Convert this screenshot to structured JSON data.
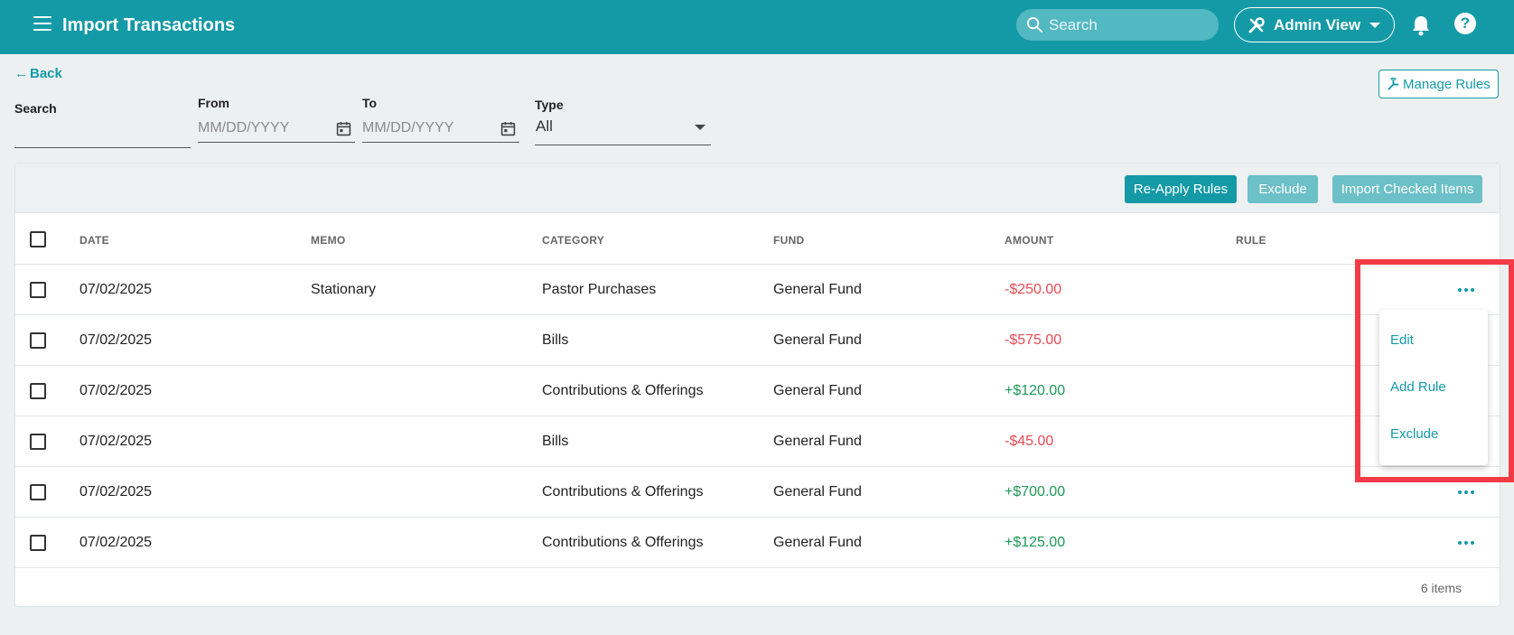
{
  "header": {
    "title": "Import Transactions",
    "search_placeholder": "Search",
    "admin_view_label": "Admin View"
  },
  "nav": {
    "back_label": "Back"
  },
  "toolbar": {
    "manage_rules_label": "Manage Rules"
  },
  "filters": {
    "search_label": "Search",
    "from_label": "From",
    "from_placeholder": "MM/DD/YYYY",
    "to_label": "To",
    "to_placeholder": "MM/DD/YYYY",
    "type_label": "Type",
    "type_value": "All"
  },
  "actions": {
    "reapply_label": "Re-Apply Rules",
    "exclude_label": "Exclude",
    "import_label": "Import Checked Items"
  },
  "table": {
    "columns": [
      "DATE",
      "MEMO",
      "CATEGORY",
      "FUND",
      "AMOUNT",
      "RULE"
    ],
    "rows": [
      {
        "date": "07/02/2025",
        "memo": "Stationary",
        "category": "Pastor Purchases",
        "fund": "General Fund",
        "amount": "-$250.00",
        "rule": ""
      },
      {
        "date": "07/02/2025",
        "memo": "",
        "category": "Bills",
        "fund": "General Fund",
        "amount": "-$575.00",
        "rule": ""
      },
      {
        "date": "07/02/2025",
        "memo": "",
        "category": "Contributions & Offerings",
        "fund": "General Fund",
        "amount": "+$120.00",
        "rule": ""
      },
      {
        "date": "07/02/2025",
        "memo": "",
        "category": "Bills",
        "fund": "General Fund",
        "amount": "-$45.00",
        "rule": ""
      },
      {
        "date": "07/02/2025",
        "memo": "",
        "category": "Contributions & Offerings",
        "fund": "General Fund",
        "amount": "+$700.00",
        "rule": ""
      },
      {
        "date": "07/02/2025",
        "memo": "",
        "category": "Contributions & Offerings",
        "fund": "General Fund",
        "amount": "+$125.00",
        "rule": ""
      }
    ],
    "item_count": "6 items"
  },
  "row_menu": {
    "items": [
      "Edit",
      "Add Rule",
      "Exclude"
    ]
  },
  "colors": {
    "brand": "#149aa6",
    "negative": "#e84a55",
    "positive": "#1f9a57",
    "highlight": "#f23b46"
  },
  "icons": [
    "menu-icon",
    "search-icon",
    "tools-icon",
    "bell-icon",
    "help-icon",
    "back-arrow-icon",
    "manage-rules-icon",
    "calendar-icon",
    "more-icon"
  ]
}
